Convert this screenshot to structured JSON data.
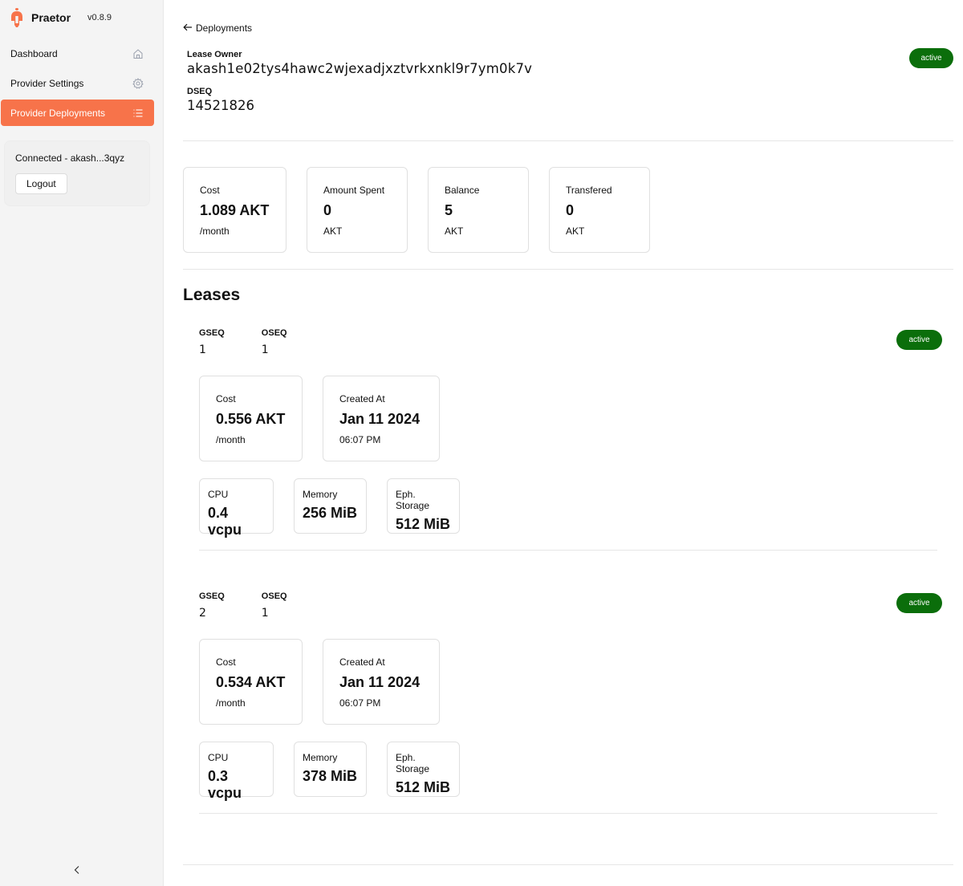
{
  "app": {
    "name": "Praetor",
    "version": "v0.8.9"
  },
  "sidebar": {
    "items": [
      {
        "label": "Dashboard",
        "icon": "home-icon"
      },
      {
        "label": "Provider Settings",
        "icon": "gear-icon"
      },
      {
        "label": "Provider Deployments",
        "icon": "list-icon",
        "active": true
      }
    ],
    "account": {
      "connected_text": "Connected - akash...3qyz",
      "logout_label": "Logout"
    }
  },
  "header": {
    "back_label": "Deployments",
    "lease_owner_label": "Lease Owner",
    "lease_owner_value": "akash1e02tys4hawc2wjexadjxztvrkxnkl9r7ym0k7v",
    "dseq_label": "DSEQ",
    "dseq_value": "14521826",
    "status": "active"
  },
  "stats": [
    {
      "label": "Cost",
      "value": "1.089 AKT",
      "unit": "/month"
    },
    {
      "label": "Amount Spent",
      "value": "0",
      "unit": "AKT"
    },
    {
      "label": "Balance",
      "value": "5",
      "unit": "AKT"
    },
    {
      "label": "Transfered",
      "value": "0",
      "unit": "AKT"
    }
  ],
  "leases_title": "Leases",
  "leases": [
    {
      "gseq_label": "GSEQ",
      "gseq": "1",
      "oseq_label": "OSEQ",
      "oseq": "1",
      "status": "active",
      "cost_label": "Cost",
      "cost_value": "0.556 AKT",
      "cost_unit": "/month",
      "created_label": "Created At",
      "created_date": "Jan 11 2024",
      "created_time": "06:07 PM",
      "cpu_label": "CPU",
      "cpu_value": "0.4 vcpu",
      "memory_label": "Memory",
      "memory_value": "256 MiB",
      "storage_label": "Eph. Storage",
      "storage_value": "512 MiB"
    },
    {
      "gseq_label": "GSEQ",
      "gseq": "2",
      "oseq_label": "OSEQ",
      "oseq": "1",
      "status": "active",
      "cost_label": "Cost",
      "cost_value": "0.534 AKT",
      "cost_unit": "/month",
      "created_label": "Created At",
      "created_date": "Jan 11 2024",
      "created_time": "06:07 PM",
      "cpu_label": "CPU",
      "cpu_value": "0.3 vcpu",
      "memory_label": "Memory",
      "memory_value": "378 MiB",
      "storage_label": "Eph. Storage",
      "storage_value": "512 MiB"
    }
  ],
  "colors": {
    "accent": "#f7734a",
    "active_badge": "#0b6e0b",
    "sidebar_bg": "#f4f4f4"
  }
}
